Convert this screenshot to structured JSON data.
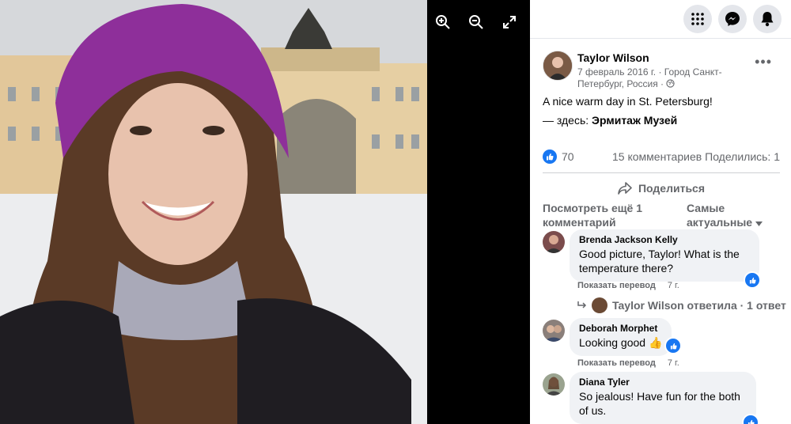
{
  "viewer": {
    "zoom_in_icon": "zoom-in-icon",
    "zoom_out_icon": "zoom-out-icon",
    "fullscreen_icon": "fullscreen-icon"
  },
  "topbar": {
    "icons": [
      "menu-grid-icon",
      "messenger-icon",
      "notifications-bell-icon"
    ]
  },
  "post": {
    "author": "Taylor Wilson",
    "meta": "7 февраль 2016 г. · Город Санкт-Петербург, Россия ·",
    "text": "A nice warm day in St. Petersburg!",
    "location_prefix": "— здесь: ",
    "location_name": "Эрмитаж Музей",
    "likes": "70",
    "comments_count": "15 комментариев",
    "shares": "Поделились: 1",
    "share_label": "Поделиться",
    "see_more": "Посмотреть ещё 1 комментарий",
    "sort_label": "Самые актуальные"
  },
  "comments": [
    {
      "name": "Brenda Jackson Kelly",
      "text": "Good picture, Taylor! What is the temperature there?",
      "translate": "Показать перевод",
      "time": "7 г."
    },
    {
      "name": "Deborah Morphet",
      "text": "Looking good 👍",
      "translate": "Показать перевод",
      "time": "7 г."
    },
    {
      "name": "Diana Tyler",
      "text": "So jealous! Have fun for the both of us."
    }
  ],
  "reply": {
    "text": "Taylor Wilson ответила · 1 ответ"
  },
  "colors": {
    "accent": "#1877f2",
    "secondary_text": "#65676b",
    "bubble": "#f0f2f5"
  }
}
